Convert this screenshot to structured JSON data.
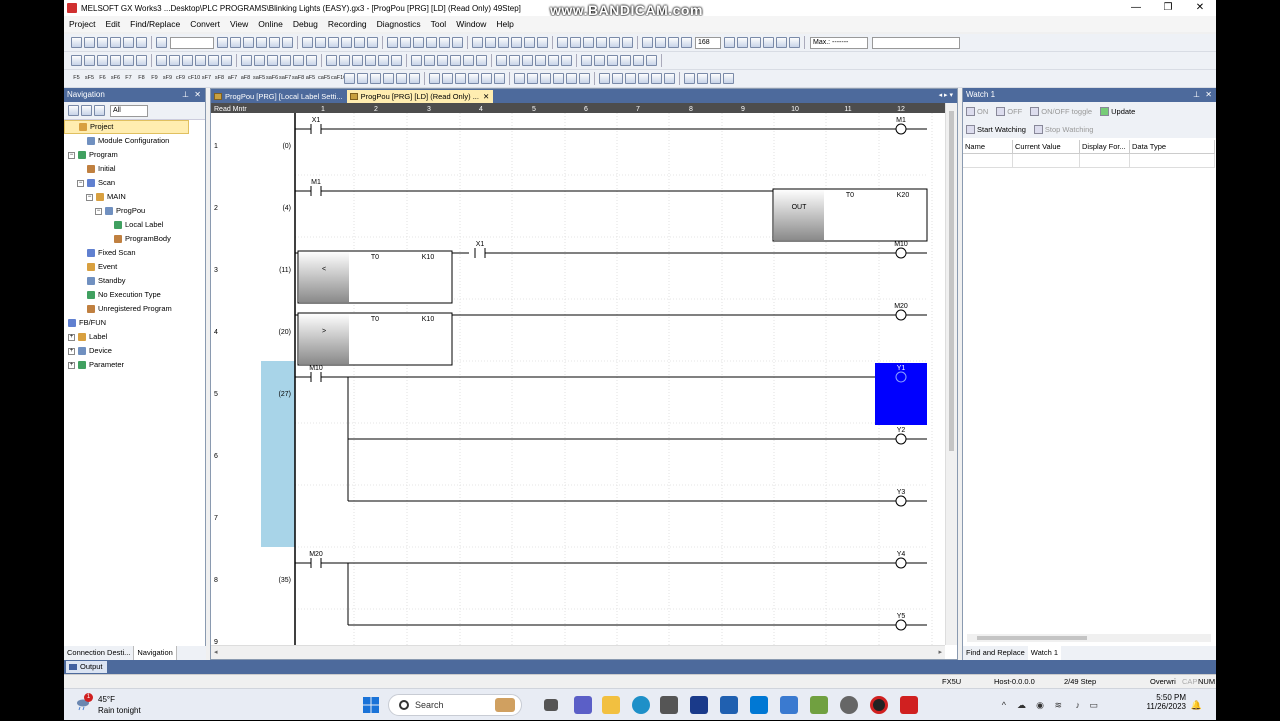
{
  "window": {
    "title": "MELSOFT GX Works3 ...Desktop\\PLC PROGRAMS\\Blinking Lights (EASY).gx3 - [ProgPou [PRG] [LD] (Read Only) 49Step]",
    "watermark": "www.BANDICAM.com",
    "minimize": "—",
    "restore": "❐",
    "close": "✕"
  },
  "menu": [
    "Project",
    "Edit",
    "Find/Replace",
    "Convert",
    "View",
    "Online",
    "Debug",
    "Recording",
    "Diagnostics",
    "Tool",
    "Window",
    "Help"
  ],
  "toolbar": {
    "zoom": "168",
    "watch_combo": "Max.: -------",
    "fkeys": [
      "F5",
      "sF5",
      "F6",
      "sF6",
      "F7",
      "F8",
      "F9",
      "sF9",
      "cF9",
      "cF10",
      "sF7",
      "sF8",
      "aF7",
      "aF8",
      "saF5",
      "saF6",
      "saF7",
      "saF8",
      "aF5",
      "caF5",
      "caF10"
    ]
  },
  "navigation": {
    "title": "Navigation",
    "filter": "All",
    "tree": [
      {
        "label": "Project",
        "level": 0,
        "selected": true,
        "expander": ""
      },
      {
        "label": "Module Configuration",
        "level": 1,
        "expander": ""
      },
      {
        "label": "Program",
        "level": 0,
        "expander": "−"
      },
      {
        "label": "Initial",
        "level": 1,
        "expander": ""
      },
      {
        "label": "Scan",
        "level": 1,
        "expander": "−"
      },
      {
        "label": "MAIN",
        "level": 2,
        "expander": "−"
      },
      {
        "label": "ProgPou",
        "level": 3,
        "expander": "−"
      },
      {
        "label": "Local Label",
        "level": 4,
        "expander": ""
      },
      {
        "label": "ProgramBody",
        "level": 4,
        "expander": ""
      },
      {
        "label": "Fixed Scan",
        "level": 1,
        "expander": ""
      },
      {
        "label": "Event",
        "level": 1,
        "expander": ""
      },
      {
        "label": "Standby",
        "level": 1,
        "expander": ""
      },
      {
        "label": "No Execution Type",
        "level": 1,
        "expander": ""
      },
      {
        "label": "Unregistered Program",
        "level": 1,
        "expander": ""
      },
      {
        "label": "FB/FUN",
        "level": 0,
        "expander": ""
      },
      {
        "label": "Label",
        "level": 0,
        "expander": "+"
      },
      {
        "label": "Device",
        "level": 0,
        "expander": "+"
      },
      {
        "label": "Parameter",
        "level": 0,
        "expander": "+"
      }
    ],
    "tabs": [
      "Connection Desti...",
      "Navigation"
    ]
  },
  "editor": {
    "tabs": [
      "ProgPou [PRG] [Local Label Setti...",
      "ProgPou [PRG] [LD] (Read Only) ..."
    ],
    "mode": "Read Mntr",
    "columns": [
      "1",
      "2",
      "3",
      "4",
      "5",
      "6",
      "7",
      "8",
      "9",
      "10",
      "11",
      "12"
    ],
    "rows": [
      {
        "num": "1",
        "step": "(0)"
      },
      {
        "num": "2",
        "step": "(4)"
      },
      {
        "num": "3",
        "step": "(11)"
      },
      {
        "num": "4",
        "step": "(20)"
      },
      {
        "num": "5",
        "step": "(27)"
      },
      {
        "num": "6",
        "step": ""
      },
      {
        "num": "7",
        "step": ""
      },
      {
        "num": "8",
        "step": "(35)"
      },
      {
        "num": "9",
        "step": ""
      }
    ],
    "devices": {
      "r1_contact": "X1",
      "r1_coil": "M1",
      "r2_contact": "M1",
      "r2_instr": "OUT",
      "r2_op1": "T0",
      "r2_op2": "K20",
      "r3_instr": "<",
      "r3_op1": "T0",
      "r3_op2": "K10",
      "r3_contact": "X1",
      "r3_coil": "M10",
      "r4_instr": ">",
      "r4_op1": "T0",
      "r4_op2": "K10",
      "r4_coil": "M20",
      "r5_contact": "M10",
      "r5_coil": "Y1",
      "r6_coil": "Y2",
      "r7_coil": "Y3",
      "r8_contact": "M20",
      "r8_coil": "Y4",
      "r9_coil": "Y5"
    }
  },
  "watch": {
    "title": "Watch 1",
    "tools": {
      "on": "ON",
      "off": "OFF",
      "toggle": "ON/OFF toggle",
      "update": "Update",
      "start": "Start Watching",
      "stop": "Stop Watching"
    },
    "columns": [
      "Name",
      "Current Value",
      "Display For...",
      "Data Type"
    ],
    "tabs": [
      "Find and Replace",
      "Watch 1"
    ]
  },
  "output": {
    "label": "Output"
  },
  "status": {
    "cpu": "FX5U",
    "host": "Host-0.0.0.0",
    "step": "2/49 Step",
    "overwrite": "Overwri",
    "cap": "CAP",
    "num": "NUM"
  },
  "taskbar": {
    "temp": "45°F",
    "condition": "Rain tonight",
    "badge": "1",
    "search": "Search",
    "time": "5:50 PM",
    "date": "11/26/2023"
  },
  "colors": {
    "accent": "#4d6a9c",
    "highlight_coil": "#0000ff",
    "selection": "#a8d4e8"
  }
}
